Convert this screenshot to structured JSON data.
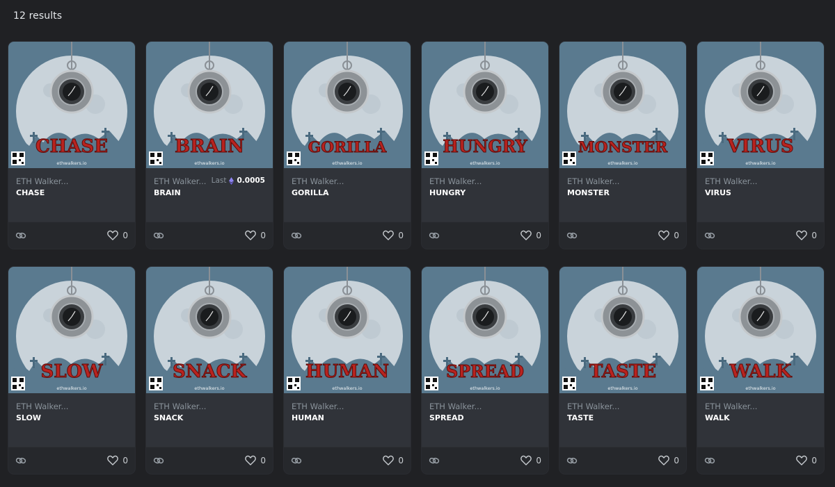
{
  "header": {
    "results_label": "12 results"
  },
  "cards": [
    {
      "collection": "ETH Walker...",
      "name": "CHASE",
      "word": "CHASE",
      "likes": "0",
      "last_label": "",
      "last_price": ""
    },
    {
      "collection": "ETH Walker...",
      "name": "BRAIN",
      "word": "BRAIN",
      "likes": "0",
      "last_label": "Last",
      "last_price": "0.0005"
    },
    {
      "collection": "ETH Walker...",
      "name": "GORILLA",
      "word": "GORILLA",
      "likes": "0",
      "last_label": "",
      "last_price": ""
    },
    {
      "collection": "ETH Walker...",
      "name": "HUNGRY",
      "word": "HUNGRY",
      "likes": "0",
      "last_label": "",
      "last_price": ""
    },
    {
      "collection": "ETH Walker...",
      "name": "MONSTER",
      "word": "MONSTER",
      "likes": "0",
      "last_label": "",
      "last_price": ""
    },
    {
      "collection": "ETH Walker...",
      "name": "VIRUS",
      "word": "VIRUS",
      "likes": "0",
      "last_label": "",
      "last_price": ""
    },
    {
      "collection": "ETH Walker...",
      "name": "SLOW",
      "word": "SLOW",
      "likes": "0",
      "last_label": "",
      "last_price": ""
    },
    {
      "collection": "ETH Walker...",
      "name": "SNACK",
      "word": "SNACK",
      "likes": "0",
      "last_label": "",
      "last_price": ""
    },
    {
      "collection": "ETH Walker...",
      "name": "HUMAN",
      "word": "HUMAN",
      "likes": "0",
      "last_label": "",
      "last_price": ""
    },
    {
      "collection": "ETH Walker...",
      "name": "SPREAD",
      "word": "SPREAD",
      "likes": "0",
      "last_label": "",
      "last_price": ""
    },
    {
      "collection": "ETH Walker...",
      "name": "TASTE",
      "word": "TASTE",
      "likes": "0",
      "last_label": "",
      "last_price": ""
    },
    {
      "collection": "ETH Walker...",
      "name": "WALK",
      "word": "WALK",
      "likes": "0",
      "last_label": "",
      "last_price": ""
    }
  ],
  "art": {
    "watermark": "ethwalkers.io"
  },
  "icons": {
    "link": "link-icon",
    "favorite": "heart-icon",
    "currency": "ethereum-icon"
  },
  "colors": {
    "page_bg": "#202124",
    "card_bg": "#303339",
    "art_bg": "#5a7a8f",
    "title_red": "#b8231f"
  }
}
